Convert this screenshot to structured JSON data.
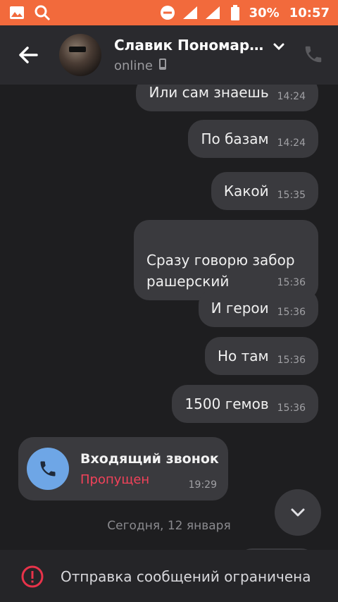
{
  "status_bar": {
    "battery": "30%",
    "time": "10:57",
    "icons": [
      "gallery-icon",
      "search-icon",
      "dnd-icon",
      "signal-icon",
      "signal-icon",
      "battery-icon"
    ],
    "accent_color": "#f26a3c"
  },
  "header": {
    "contact_name": "Славик Пономар…",
    "status": "online",
    "icons": [
      "back-arrow-icon",
      "chevron-down-icon",
      "mobile-device-icon",
      "phone-icon"
    ]
  },
  "messages": [
    {
      "text": "Или сам знаешь",
      "time": "14:24"
    },
    {
      "text": "По базам",
      "time": "14:24"
    },
    {
      "text": "Какой",
      "time": "15:35"
    },
    {
      "text": "Сразу говорю забор\nрашерский",
      "time": "15:36"
    },
    {
      "text": "И герои",
      "time": "15:36"
    },
    {
      "text": "Но там",
      "time": "15:36"
    },
    {
      "text": "1500 гемов",
      "time": "15:36"
    }
  ],
  "call": {
    "title": "Входящий звонок",
    "subtitle": "Пропущен",
    "time": "19:29",
    "subtitle_color": "#f2425a",
    "circle_color": "#6ea6e6"
  },
  "date_separator": "Сегодня, 12 января",
  "bottom_bar": {
    "text": "Отправка сообщений ограничена",
    "warn_color": "#e8334a"
  }
}
